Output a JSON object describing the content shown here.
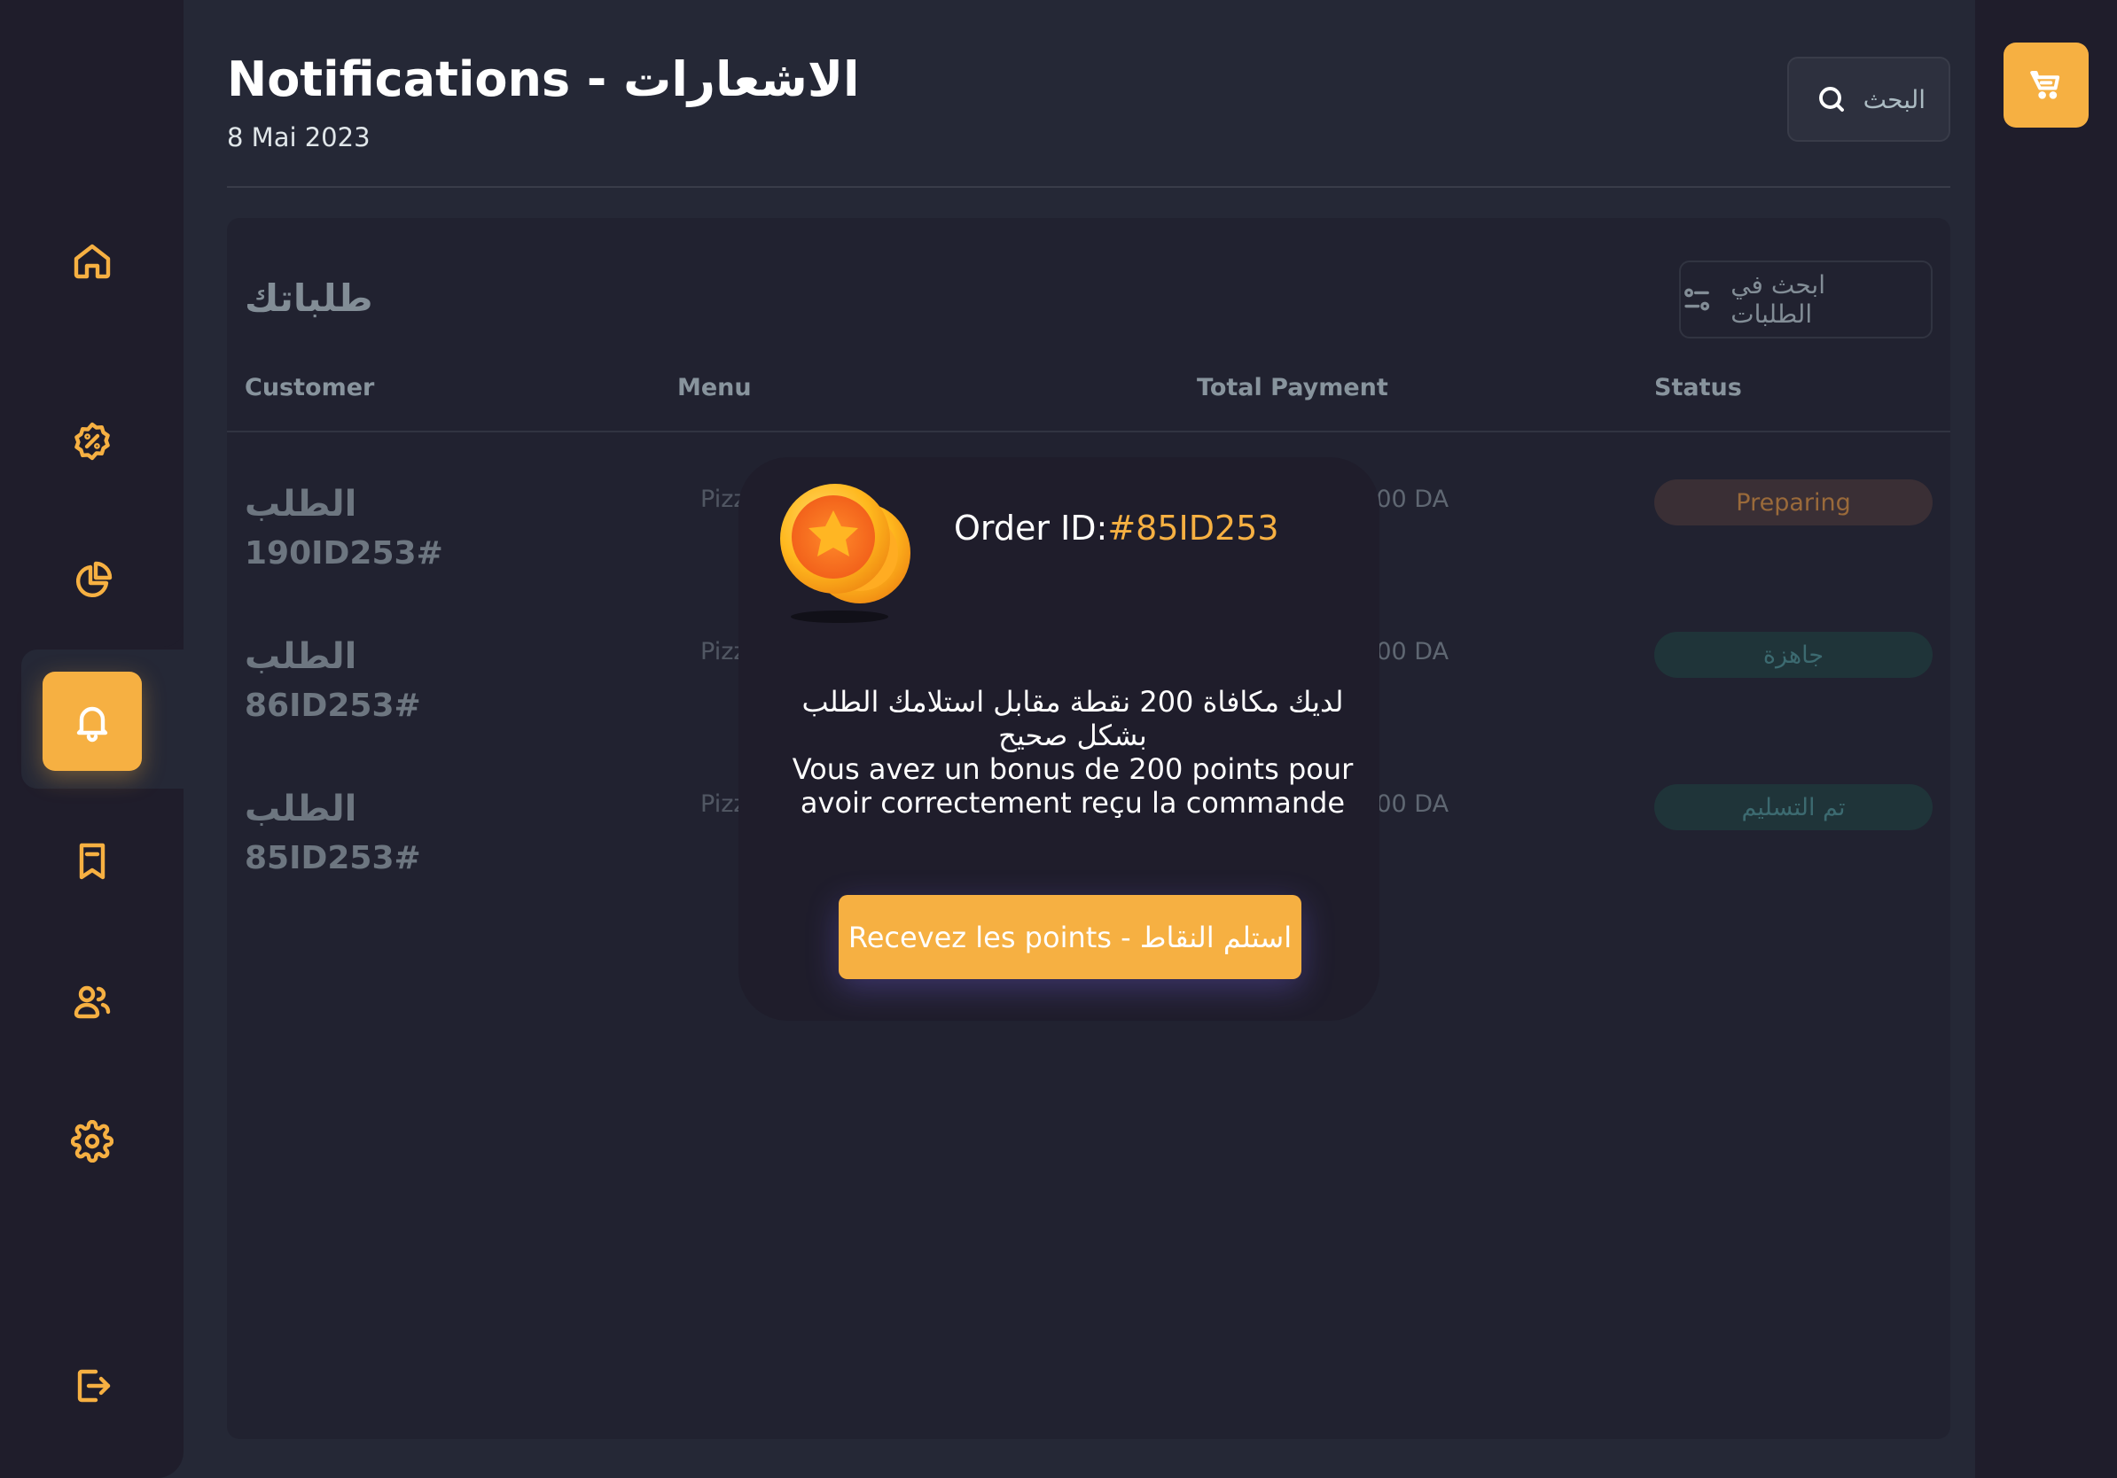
{
  "header": {
    "title": "Notifications - الاشعارات",
    "date": "8 Mai 2023",
    "search_placeholder": "البحث"
  },
  "sidebar": {
    "items": [
      {
        "name": "home",
        "icon": "home-icon"
      },
      {
        "name": "discount",
        "icon": "discount-icon"
      },
      {
        "name": "dashboard",
        "icon": "pie-chart-icon"
      },
      {
        "name": "notifications",
        "icon": "bell-icon",
        "active": true
      },
      {
        "name": "orders",
        "icon": "bookmark-icon"
      },
      {
        "name": "users",
        "icon": "users-icon"
      },
      {
        "name": "settings",
        "icon": "gear-icon"
      },
      {
        "name": "logout",
        "icon": "logout-icon"
      }
    ]
  },
  "cart": {
    "icon": "cart-icon"
  },
  "orders": {
    "heading": "طلباتك",
    "filter_placeholder": "ابحث في الطلبات",
    "columns": [
      "Customer",
      "Menu",
      "Total Payment",
      "Status"
    ],
    "rows": [
      {
        "title": "الطلب",
        "id": "190ID253#",
        "menu": "Pizza P",
        "payment": "1500 DA",
        "status": "Preparing",
        "status_type": "preparing"
      },
      {
        "title": "الطلب",
        "id": "86ID253#",
        "menu": "Pizza Poulet XXL",
        "payment": "1500 DA",
        "status": "جاهزة",
        "status_type": "ready"
      },
      {
        "title": "الطلب",
        "id": "85ID253#",
        "menu": "Pizza Poul",
        "payment": "1500 DA",
        "status": "تم التسليم",
        "status_type": "delivered"
      }
    ]
  },
  "modal": {
    "order_label": "Order ID:",
    "order_id": "#85ID253",
    "message_ar": "لديك مكافاة 200 نقطة مقابل استلامك الطلب بشكل صحيح",
    "message_fr": "Vous avez un bonus de 200 points pour avoir correctement reçu la commande",
    "button_label": "Recevez les points - استلم النقاط"
  },
  "colors": {
    "accent": "#f6b042",
    "background": "#252836",
    "sidebar": "#1f1d2b"
  }
}
